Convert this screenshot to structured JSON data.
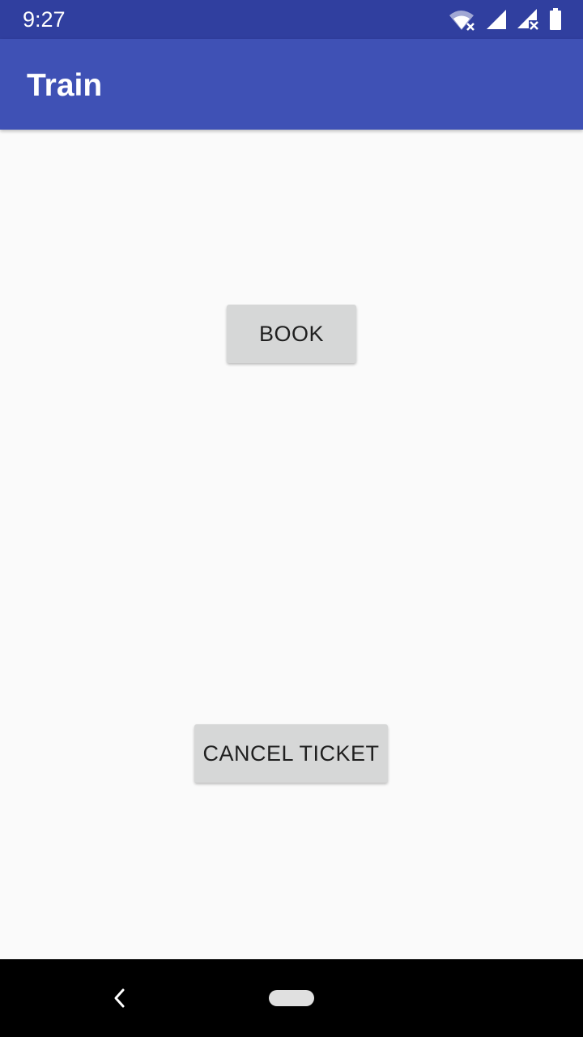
{
  "status_bar": {
    "time": "9:27",
    "icons": [
      "wifi-off-icon",
      "signal-icon",
      "signal-off-icon",
      "battery-icon"
    ]
  },
  "app_bar": {
    "title": "Train"
  },
  "main": {
    "book_label": "BOOK",
    "cancel_label": "CANCEL TICKET"
  },
  "nav_bar": {
    "icons": [
      "back-icon",
      "home-pill-icon"
    ]
  },
  "colors": {
    "status_bar": "#303f9f",
    "app_bar": "#3f51b5",
    "background": "#fafafa",
    "button": "#d6d7d7",
    "button_text": "#1f1f1f",
    "nav_bar": "#000000"
  }
}
